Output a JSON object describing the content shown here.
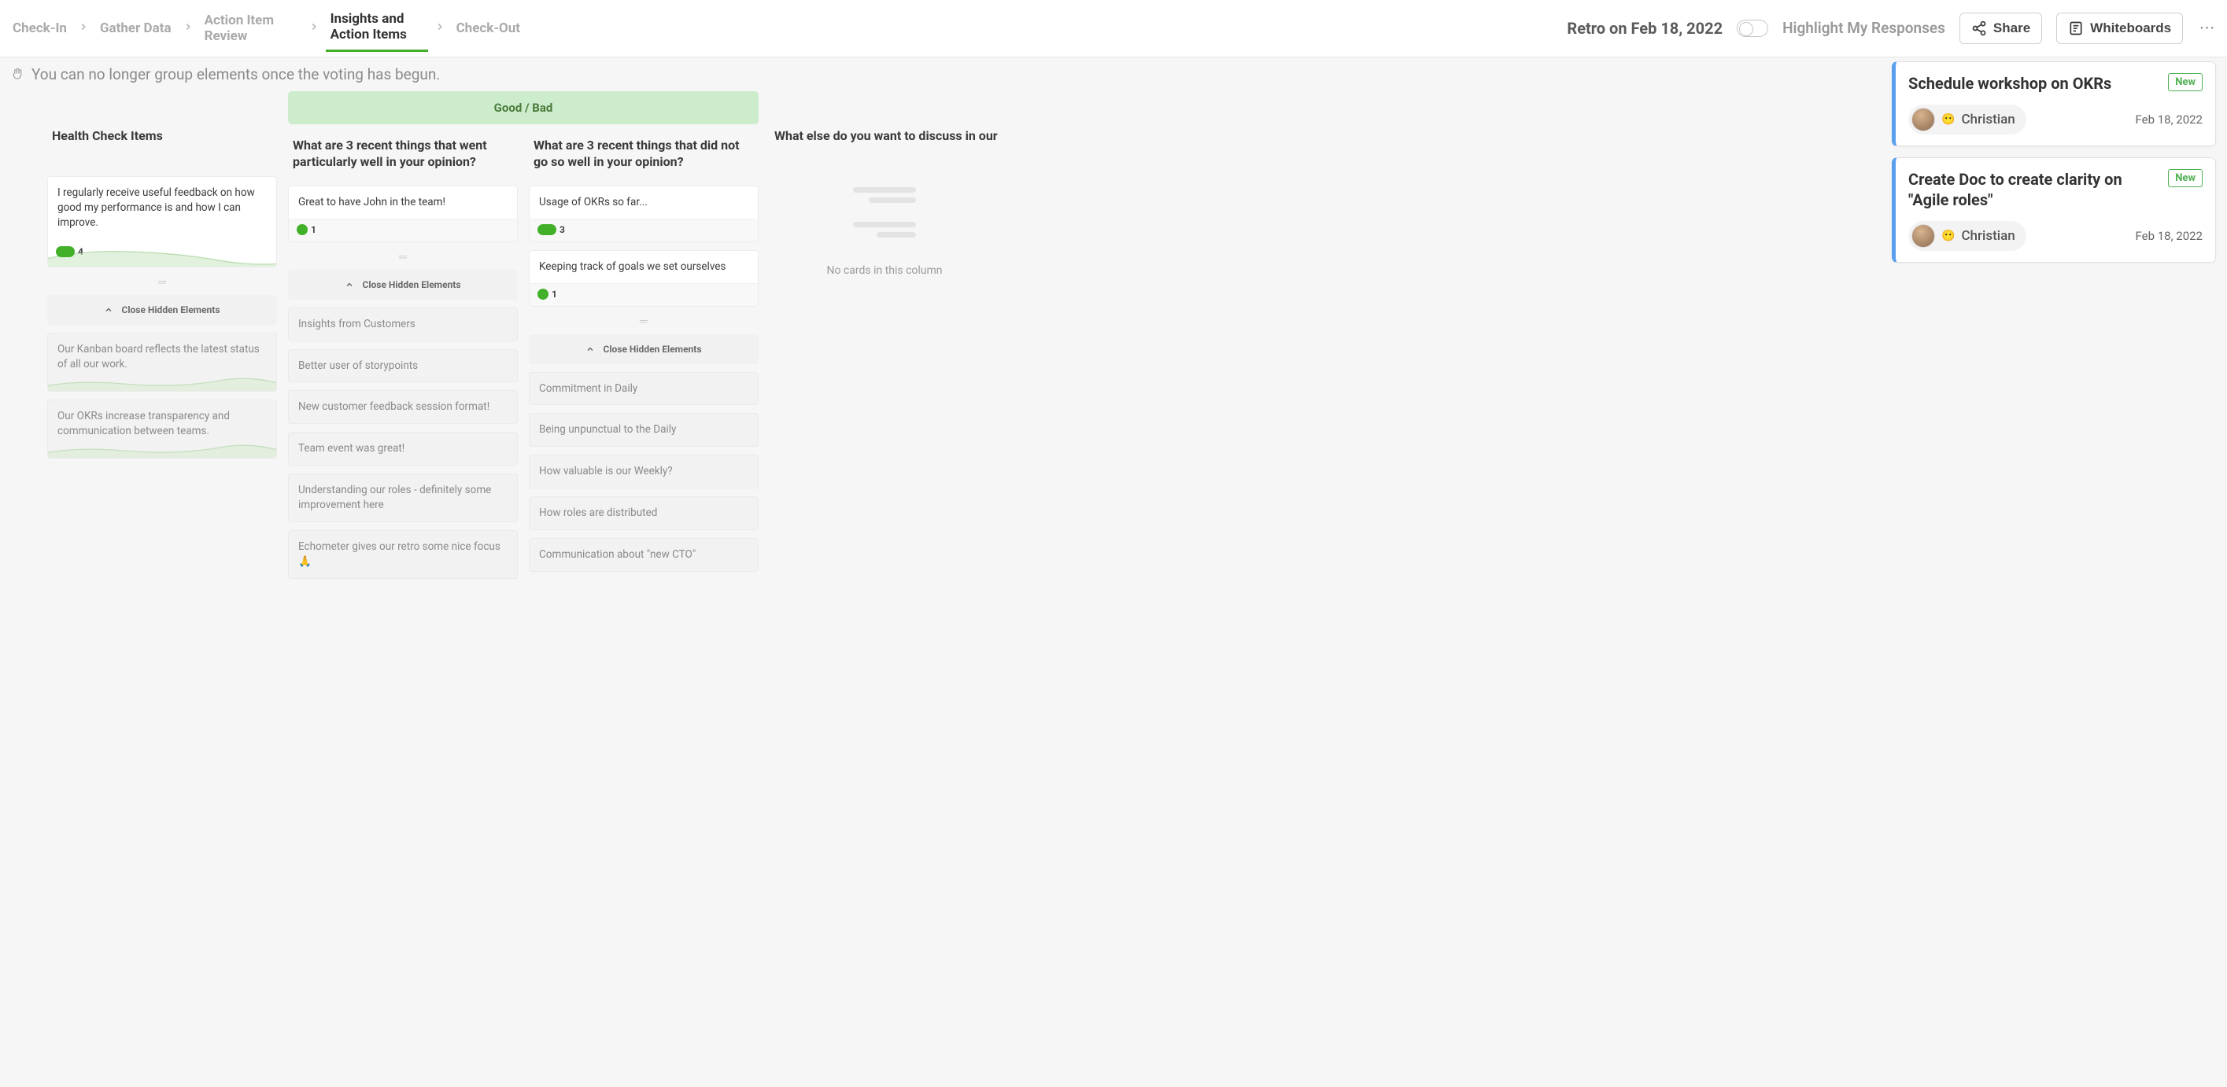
{
  "header": {
    "steps": [
      "Check-In",
      "Gather Data",
      "Action Item Review",
      "Insights and Action Items",
      "Check-Out"
    ],
    "activeIndex": 3,
    "retroTitle": "Retro on Feb 18, 2022",
    "toggleLabel": "Highlight My Responses",
    "shareLabel": "Share",
    "whiteboardsLabel": "Whiteboards"
  },
  "notice": "You can no longer group elements once the voting has begun.",
  "goodBadLabel": "Good / Bad",
  "closeHiddenLabel": "Close Hidden Elements",
  "columns": {
    "health": {
      "title": "Health Check Items",
      "top": [
        {
          "text": "I regularly receive useful feedback on how good my performance is and how I can improve.",
          "votes": 4
        }
      ],
      "hidden": [
        "Our Kanban board reflects the latest status of all our work.",
        "Our OKRs increase transparency and communication between teams."
      ]
    },
    "good": {
      "title": "What are 3 recent things that went particularly well in your opinion?",
      "top": [
        {
          "text": "Great to have John in the team!",
          "votes": 1
        }
      ],
      "hidden": [
        "Insights from Customers",
        "Better user of storypoints",
        "New customer feedback session format!",
        "Team event was great!",
        "Understanding our roles - definitely some improvement here",
        "Echometer gives our retro some nice focus 🙏"
      ]
    },
    "bad": {
      "title": "What are 3 recent things that did not go so well in your opinion?",
      "top": [
        {
          "text": "Usage of OKRs so far...",
          "votes": 3
        },
        {
          "text": "Keeping track of goals we set ourselves",
          "votes": 1
        }
      ],
      "hidden": [
        "Commitment in Daily",
        "Being unpunctual to the Daily",
        "How valuable is our Weekly?",
        "How roles are distributed",
        "Communication about \"new CTO\""
      ]
    },
    "else": {
      "title": "What else do you want to discuss in our retro?",
      "emptyText": "No cards in this column"
    }
  },
  "actions": [
    {
      "title": "Schedule workshop on OKRs",
      "badge": "New",
      "assignee": "Christian",
      "date": "Feb 18, 2022"
    },
    {
      "title": "Create Doc to create clarity on \"Agile roles\"",
      "badge": "New",
      "assignee": "Christian",
      "date": "Feb 18, 2022"
    }
  ]
}
